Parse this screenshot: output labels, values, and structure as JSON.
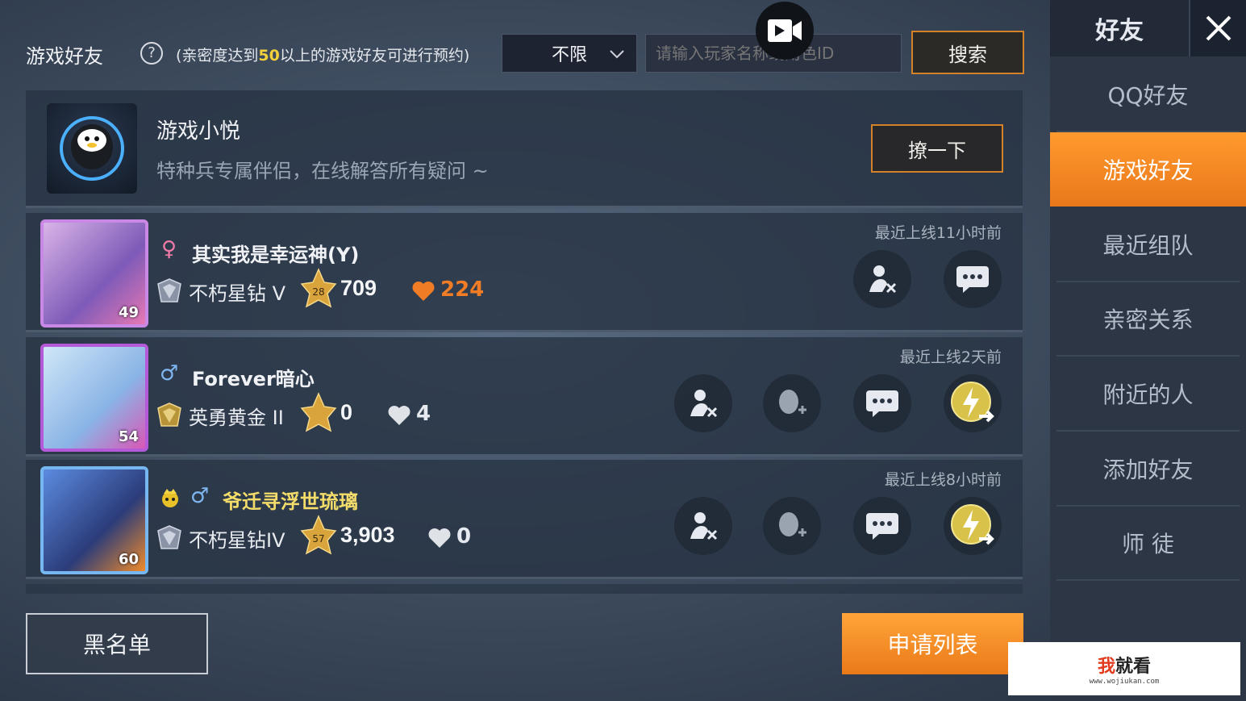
{
  "top": {
    "title": "游戏好友",
    "note_prefix": "(亲密度达到",
    "note_highlight": "50",
    "note_suffix": "以上的游戏好友可进行预约)",
    "filter_value": "不限",
    "search_placeholder": "请输入玩家名称或角色ID",
    "search_label": "搜索"
  },
  "assistant": {
    "name": "游戏小悦",
    "desc": "特种兵专属伴侣，在线解答所有疑问 ~",
    "button": "撩一下"
  },
  "friends": [
    {
      "last_online": "最近上线11小时前",
      "gender": "♀",
      "name": "其实我是幸运神(Y)",
      "rank": "不朽星钻 V",
      "star_level": "28",
      "stars": "709",
      "intimacy": "224",
      "avatar_level": "49"
    },
    {
      "last_online": "最近上线2天前",
      "gender": "♂",
      "name": "Forever暗心",
      "rank": "英勇黄金 II",
      "stars": "0",
      "intimacy": "4",
      "avatar_level": "54"
    },
    {
      "last_online": "最近上线8小时前",
      "gender": "♂",
      "name": "爷迁寻浮世琉璃",
      "rank": "不朽星钻IV",
      "star_level": "57",
      "stars": "3,903",
      "intimacy": "0",
      "avatar_level": "60"
    }
  ],
  "sidebar": {
    "header": "好友",
    "items": [
      {
        "label": "QQ好友"
      },
      {
        "label": "游戏好友"
      },
      {
        "label": "最近组队"
      },
      {
        "label": "亲密关系"
      },
      {
        "label": "附近的人"
      },
      {
        "label": "添加好友"
      },
      {
        "label": "师  徒"
      }
    ]
  },
  "bottom": {
    "blacklist": "黑名单",
    "apply_list": "申请列表"
  },
  "watermark": {
    "main_red": "我",
    "main": "就看",
    "sub": "www.wojiukan.com"
  },
  "colors": {
    "accent": "#e9781a",
    "highlight": "#f4d13a",
    "heart_active": "#f07c26",
    "heart_inactive": "#dfe3e8"
  }
}
